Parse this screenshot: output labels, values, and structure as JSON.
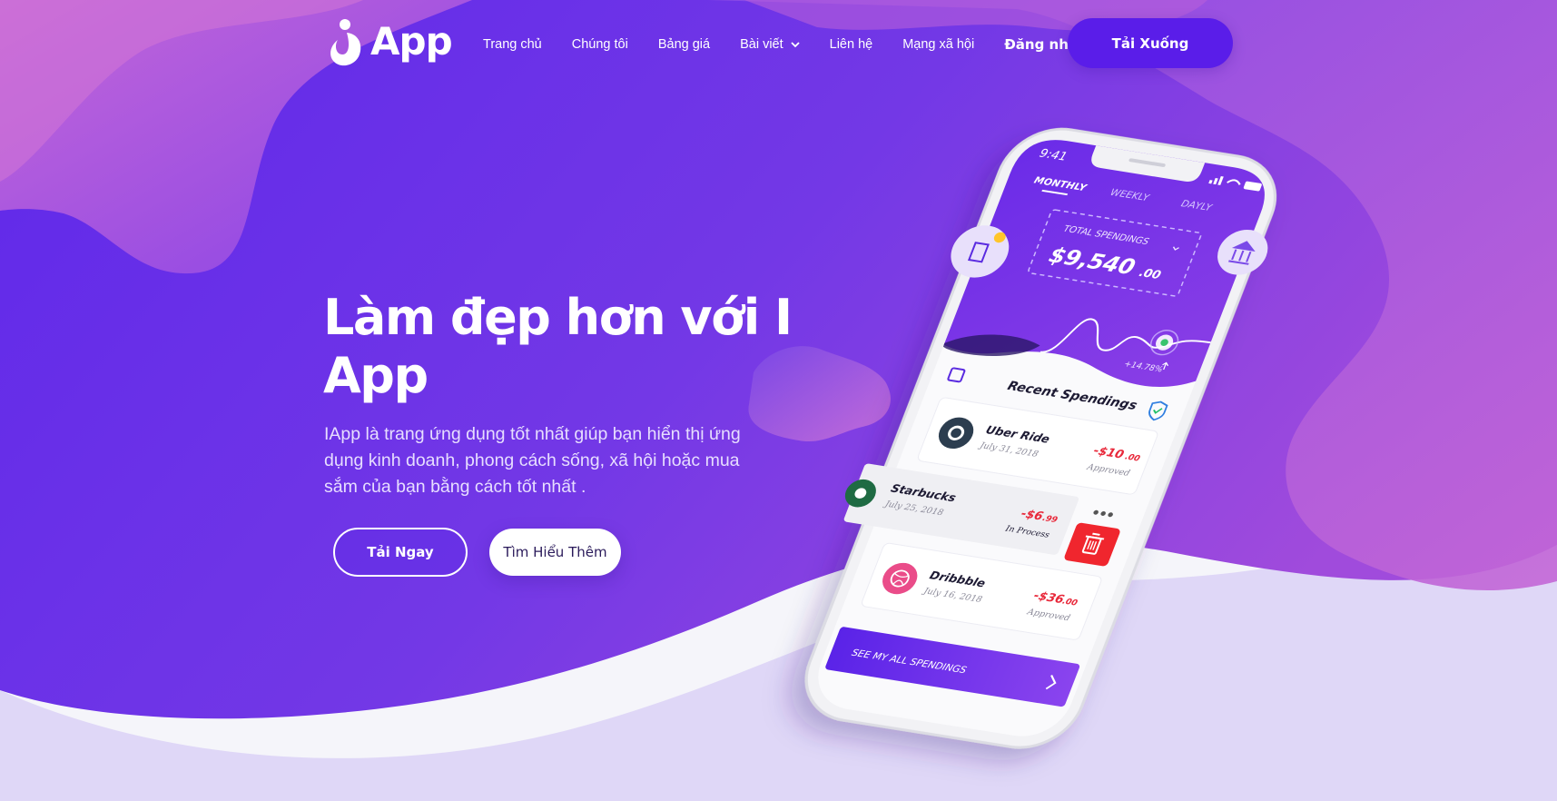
{
  "nav": {
    "logo_text": "App",
    "items": [
      {
        "label": "Trang chủ"
      },
      {
        "label": "Chúng tôi"
      },
      {
        "label": "Bảng giá"
      },
      {
        "label": "Bài viết"
      },
      {
        "label": "Liên hệ"
      },
      {
        "label": "Mạng xã hội"
      }
    ],
    "login_label": "Đăng nhập",
    "download_label": "Tải Xuống"
  },
  "hero": {
    "title": "Làm đẹp hơn với I App",
    "subtitle": "IApp là trang ứng dụng tốt nhất giúp bạn hiển thị ứng dụng kinh doanh, phong cách sống, xã hội hoặc mua sắm của bạn bằng cách tốt nhất .",
    "primary_button": "Tải Ngay",
    "secondary_button": "Tìm Hiểu Thêm"
  },
  "phone": {
    "time": "9:41",
    "tabs": [
      "MONTHLY",
      "WEEKLY",
      "DAYLY"
    ],
    "total_label": "TOTAL SPENDINGS",
    "total_value": "$9,540",
    "total_cents": ".00",
    "trend": "+14.78%",
    "recent_title": "Recent Spendings",
    "transactions": [
      {
        "name": "Uber Ride",
        "date": "July 31, 2018",
        "amount": "-$10",
        "cents": ".00",
        "status": "Approved"
      },
      {
        "name": "Starbucks",
        "date": "July 25, 2018",
        "amount": "-$6",
        "cents": ".99",
        "status": "In Process"
      },
      {
        "name": "Dribbble",
        "date": "July 16, 2018",
        "amount": "-$36",
        "cents": ".00",
        "status": "Approved"
      }
    ],
    "see_all": "SEE MY ALL SPENDINGS"
  },
  "colors": {
    "primary": "#5a1de9",
    "hero_bg": "#6a2ee8",
    "accent_pink": "#d56fd6",
    "amount_red": "#e8283a",
    "delete_red": "#f0262e"
  }
}
